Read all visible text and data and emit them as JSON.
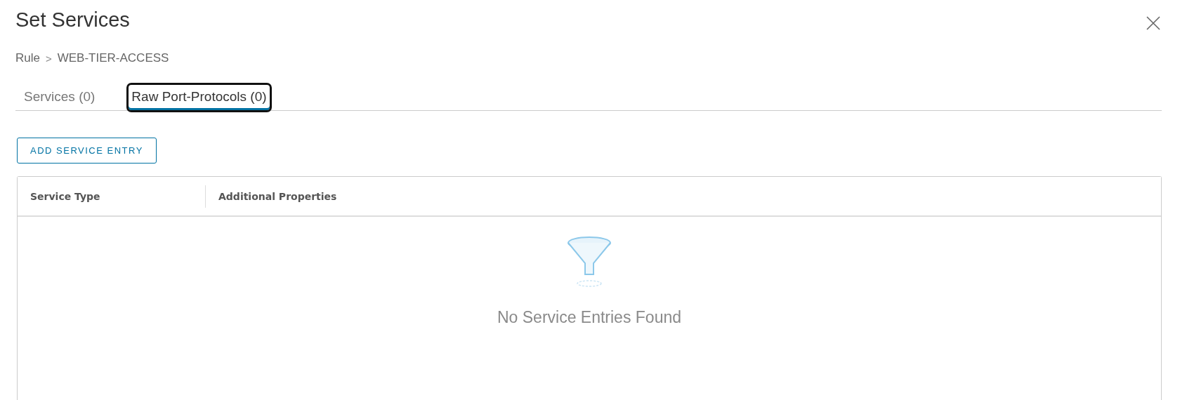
{
  "dialog": {
    "title": "Set Services"
  },
  "breadcrumb": {
    "parent": "Rule",
    "separator": ">",
    "current": "WEB-TIER-ACCESS"
  },
  "tabs": [
    {
      "label": "Services (0)",
      "selected": false
    },
    {
      "label": "Raw Port-Protocols (0)",
      "selected": true
    }
  ],
  "add_button": "ADD SERVICE ENTRY",
  "table": {
    "columns": [
      "Service Type",
      "Additional Properties"
    ],
    "empty_message": "No Service Entries Found"
  }
}
